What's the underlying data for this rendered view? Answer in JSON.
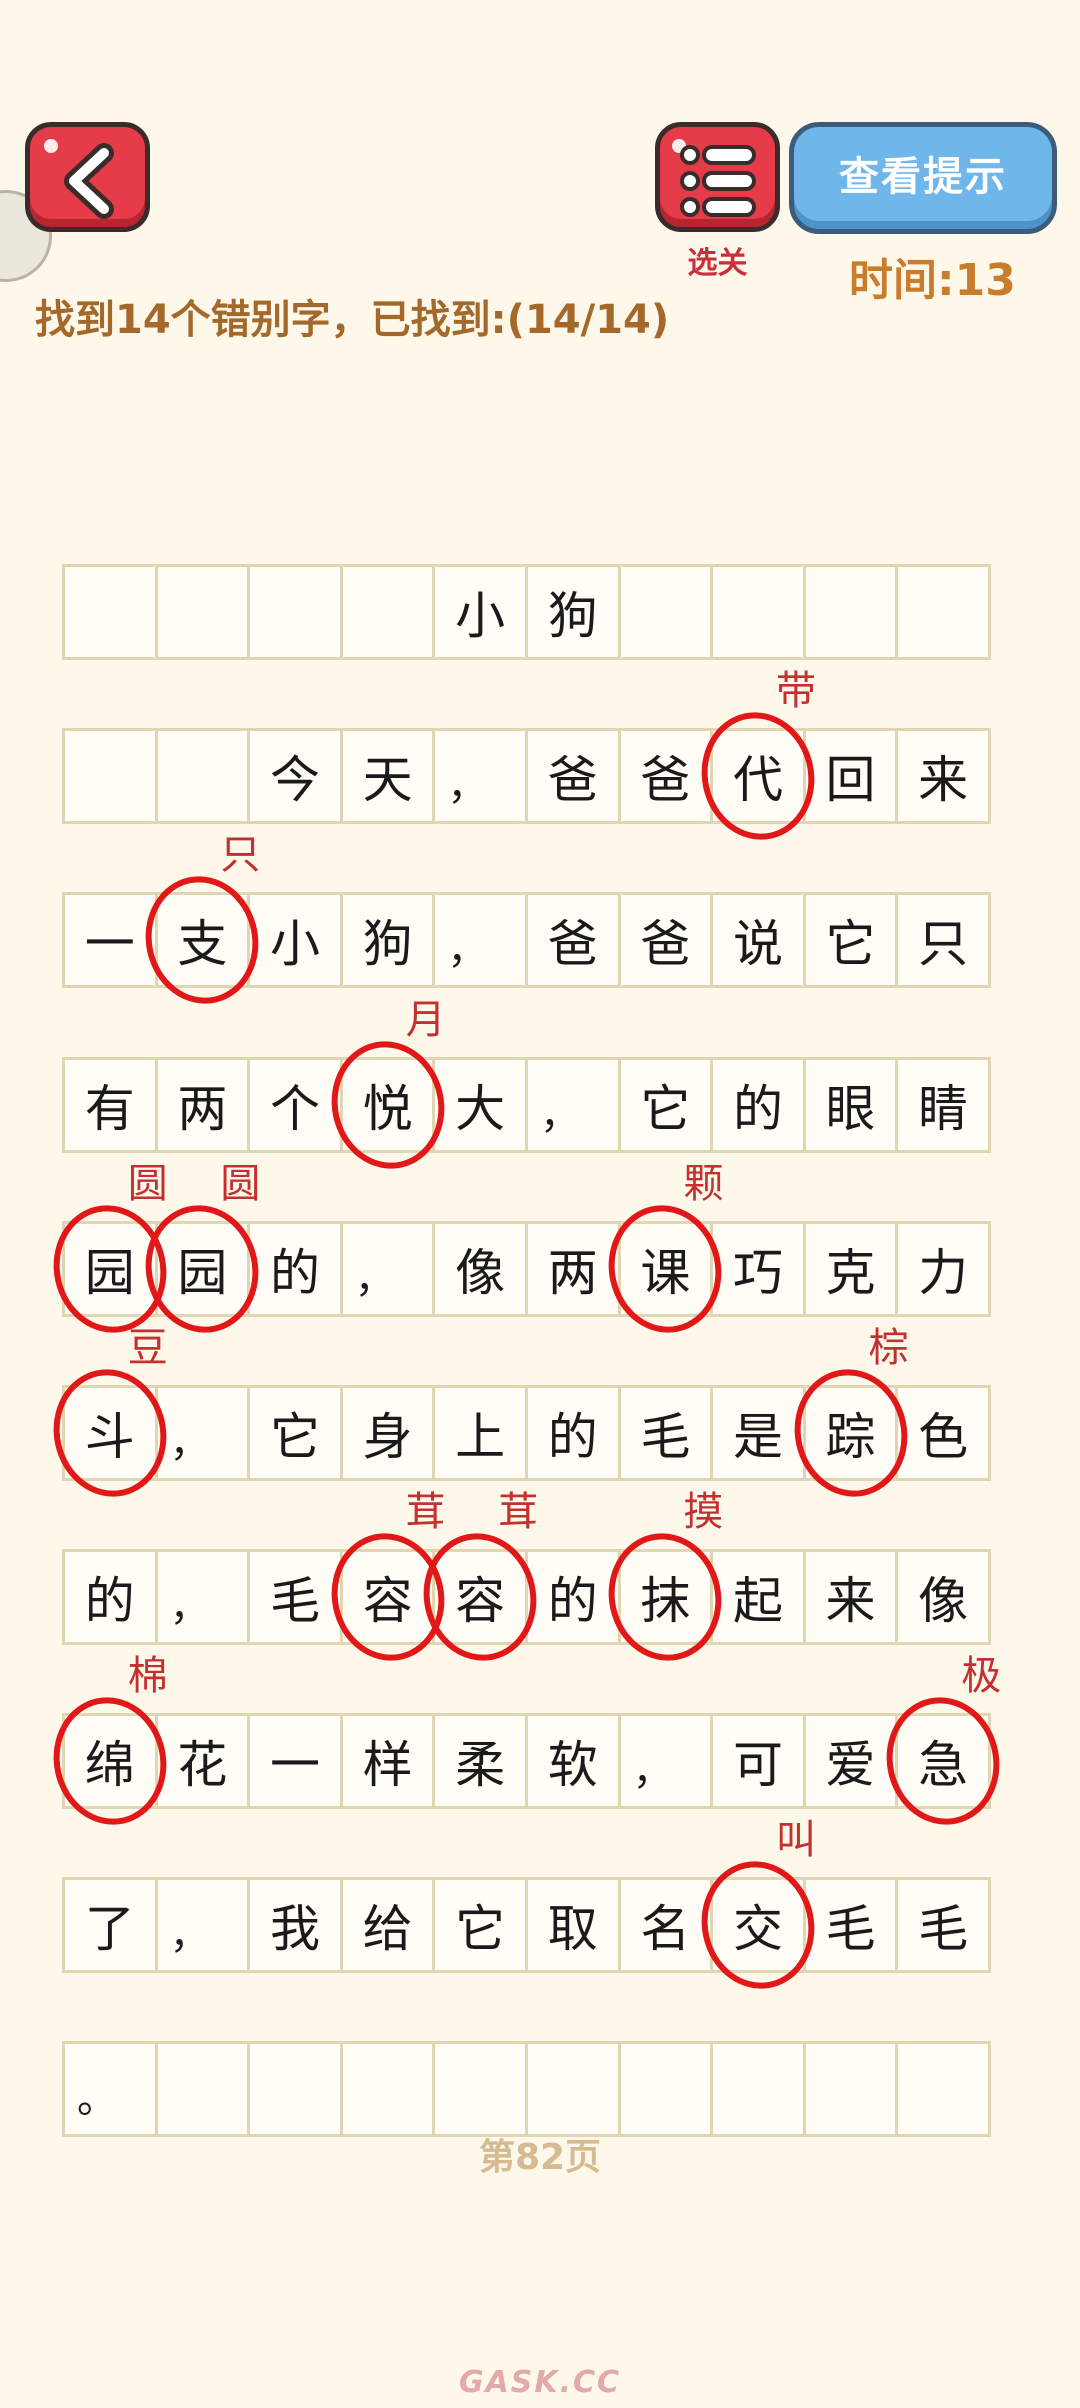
{
  "header": {
    "menu_label": "选关",
    "hint_label": "查看提示",
    "timer": "时间:13",
    "status": "找到14个错别字，已找到:(14/14)"
  },
  "grid": {
    "rows": [
      [
        "",
        "",
        "",
        "",
        "小",
        "狗",
        "",
        "",
        "",
        ""
      ],
      [
        "",
        "",
        "今",
        "天",
        "，",
        "爸",
        "爸",
        "代",
        "回",
        "来"
      ],
      [
        "一",
        "支",
        "小",
        "狗",
        "，",
        "爸",
        "爸",
        "说",
        "它",
        "只"
      ],
      [
        "有",
        "两",
        "个",
        "悦",
        "大",
        "，",
        "它",
        "的",
        "眼",
        "睛"
      ],
      [
        "园",
        "园",
        "的",
        "，",
        "像",
        "两",
        "课",
        "巧",
        "克",
        "力"
      ],
      [
        "斗",
        "，",
        "它",
        "身",
        "上",
        "的",
        "毛",
        "是",
        "踪",
        "色"
      ],
      [
        "的",
        "，",
        "毛",
        "容",
        "容",
        "的",
        "抹",
        "起",
        "来",
        "像"
      ],
      [
        "绵",
        "花",
        "一",
        "样",
        "柔",
        "软",
        "，",
        "可",
        "爱",
        "急"
      ],
      [
        "了",
        "，",
        "我",
        "给",
        "它",
        "取",
        "名",
        "交",
        "毛",
        "毛"
      ],
      [
        "。",
        "",
        "",
        "",
        "",
        "",
        "",
        "",
        "",
        ""
      ]
    ],
    "corrections": [
      {
        "row": 1,
        "col": 7,
        "text": "带"
      },
      {
        "row": 2,
        "col": 1,
        "text": "只"
      },
      {
        "row": 3,
        "col": 3,
        "text": "月"
      },
      {
        "row": 4,
        "col": 0,
        "text": "圆"
      },
      {
        "row": 4,
        "col": 1,
        "text": "圆"
      },
      {
        "row": 4,
        "col": 6,
        "text": "颗"
      },
      {
        "row": 5,
        "col": 0,
        "text": "豆"
      },
      {
        "row": 5,
        "col": 8,
        "text": "棕"
      },
      {
        "row": 6,
        "col": 3,
        "text": "茸"
      },
      {
        "row": 6,
        "col": 4,
        "text": "茸"
      },
      {
        "row": 6,
        "col": 6,
        "text": "摸"
      },
      {
        "row": 7,
        "col": 0,
        "text": "棉"
      },
      {
        "row": 7,
        "col": 9,
        "text": "极"
      },
      {
        "row": 8,
        "col": 7,
        "text": "叫"
      }
    ]
  },
  "footer": {
    "page_number": "第82页",
    "watermark": "GASK.CC"
  },
  "colors": {
    "background": "#fdf8ea",
    "circle": "#e21818",
    "correction": "#c43030",
    "button_red": "#e63b48",
    "button_blue": "#6fb6ea"
  }
}
